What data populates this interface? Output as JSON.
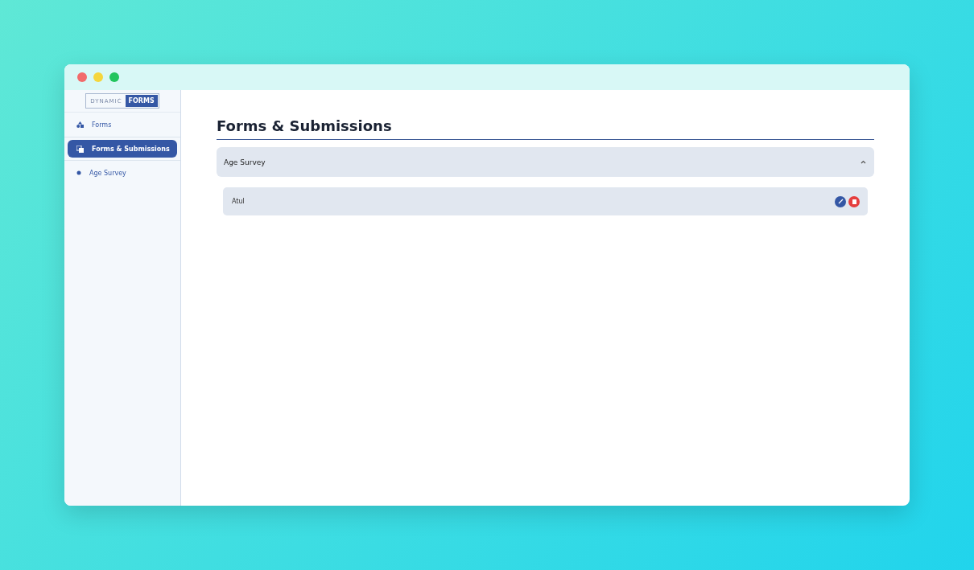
{
  "logo": {
    "left": "DYNAMIC",
    "right": "FORMS"
  },
  "sidebar": {
    "items": [
      {
        "label": "Forms",
        "kind": "shapes",
        "selected": false
      },
      {
        "label": "Forms & Submissions",
        "kind": "stack",
        "selected": true
      },
      {
        "label": "Age Survey",
        "kind": "dot",
        "selected": false
      }
    ]
  },
  "page": {
    "title": "Forms & Submissions"
  },
  "forms": [
    {
      "title": "Age Survey",
      "expanded": true,
      "submissions": [
        {
          "name": "Atul"
        }
      ]
    }
  ]
}
